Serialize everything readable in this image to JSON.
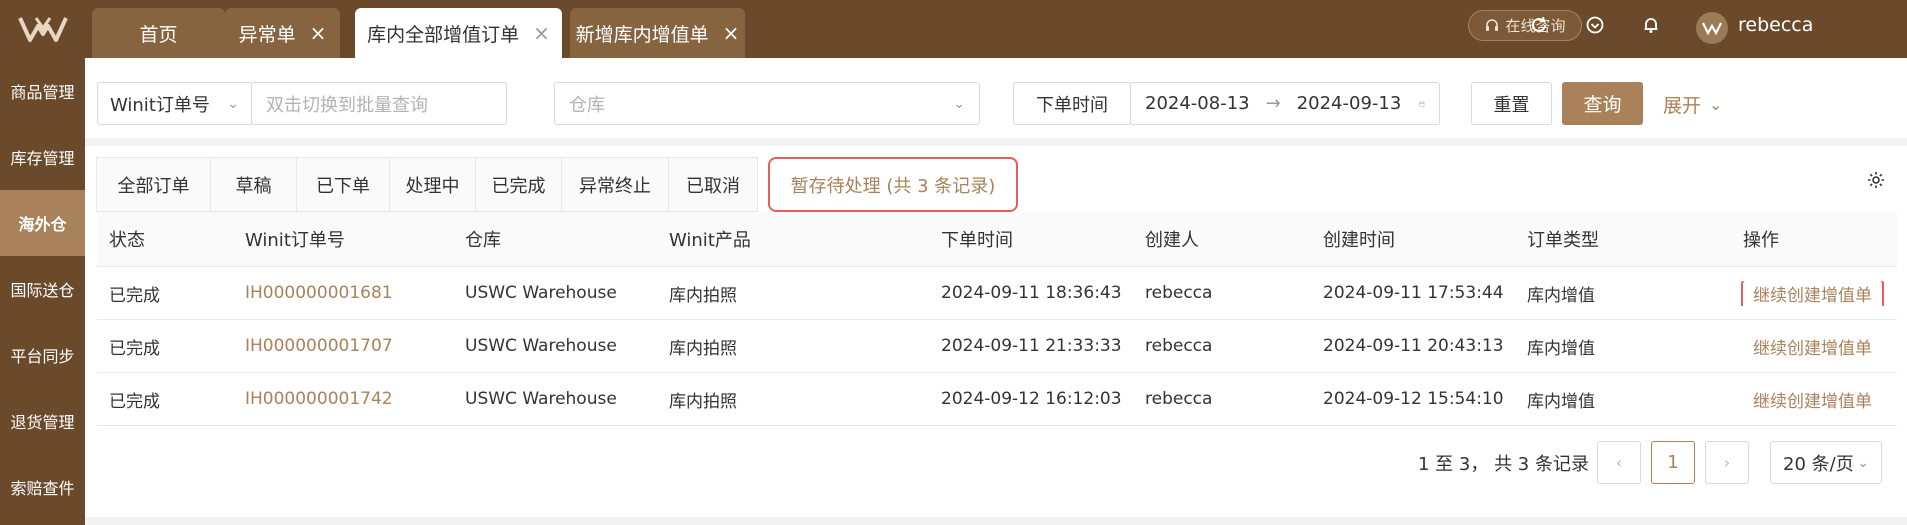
{
  "sidebar": {
    "items": [
      {
        "label": "商品管理"
      },
      {
        "label": "库存管理"
      },
      {
        "label": "海外仓"
      },
      {
        "label": "国际送仓"
      },
      {
        "label": "平台同步"
      },
      {
        "label": "退货管理"
      },
      {
        "label": "索赔查件"
      }
    ],
    "active_index": 2
  },
  "tabs": [
    {
      "label": "首页"
    },
    {
      "label": "异常单"
    },
    {
      "label": "库内全部增值订单"
    },
    {
      "label": "新增库内增值单"
    }
  ],
  "tab_close": "×",
  "header": {
    "consult_label": "在线咨询",
    "username": "rebecca",
    "lang_icon_text": "文A"
  },
  "filters": {
    "order_type_select": "Winit订单号",
    "batch_placeholder": "双击切换到批量查询",
    "warehouse_placeholder": "仓库",
    "date_type_label": "下单时间",
    "date_start": "2024-08-13",
    "date_end": "2024-09-13",
    "date_separator": "→",
    "reset_label": "重置",
    "query_label": "查询",
    "expand_label": "展开"
  },
  "status_tabs": [
    {
      "label": "全部订单"
    },
    {
      "label": "草稿"
    },
    {
      "label": "已下单"
    },
    {
      "label": "处理中"
    },
    {
      "label": "已完成"
    },
    {
      "label": "异常终止"
    },
    {
      "label": "已取消"
    },
    {
      "label": "暂存待处理 (共 3 条记录)"
    }
  ],
  "table": {
    "columns": [
      "状态",
      "Winit订单号",
      "仓库",
      "Winit产品",
      "下单时间",
      "创建人",
      "创建时间",
      "订单类型",
      "操作"
    ],
    "rows": [
      [
        "已完成",
        "IH000000001681",
        "USWC Warehouse",
        "库内拍照",
        "2024-09-11 18:36:43",
        "rebecca",
        "2024-09-11 17:53:44",
        "库内增值",
        "继续创建增值单"
      ],
      [
        "已完成",
        "IH000000001707",
        "USWC Warehouse",
        "库内拍照",
        "2024-09-11 21:33:33",
        "rebecca",
        "2024-09-11 20:43:13",
        "库内增值",
        "继续创建增值单"
      ],
      [
        "已完成",
        "IH000000001742",
        "USWC Warehouse",
        "库内拍照",
        "2024-09-12 16:12:03",
        "rebecca",
        "2024-09-12 15:54:10",
        "库内增值",
        "继续创建增值单"
      ]
    ]
  },
  "pagination": {
    "summary": "1 至 3， 共 3 条记录",
    "current_page": "1",
    "prev": "‹",
    "next": "›",
    "page_size": "20 条/页"
  },
  "colors": {
    "brand_dark": "#6b4a2b",
    "brand_accent": "#a9825b",
    "highlight_red": "#e85c5c"
  }
}
